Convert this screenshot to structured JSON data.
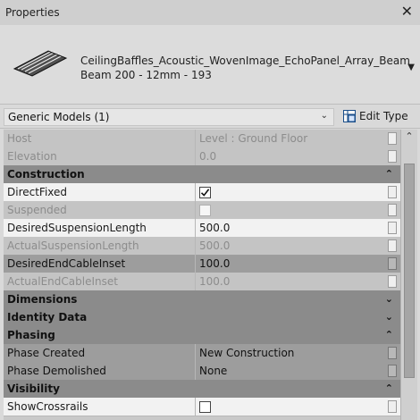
{
  "window": {
    "title": "Properties",
    "close_icon": "close-icon"
  },
  "type_header": {
    "name_line1": "CeilingBaffles_Acoustic_WovenImage_EchoPanel_Array_Beam",
    "name_line2": "Beam 200 - 12mm - 193"
  },
  "selector": {
    "label": "Generic Models (1)",
    "edit_type_label": "Edit Type"
  },
  "rows": [
    {
      "kind": "property",
      "state": "disabled",
      "name": "Host",
      "value": "Level : Ground Floor",
      "value_type": "text"
    },
    {
      "kind": "property",
      "state": "disabled",
      "name": "Elevation",
      "value": "0.0",
      "value_type": "text"
    },
    {
      "kind": "category",
      "name": "Construction",
      "expanded": true
    },
    {
      "kind": "property",
      "state": "normal",
      "name": "DirectFixed",
      "value": "",
      "value_type": "checkbox",
      "checked": true
    },
    {
      "kind": "property",
      "state": "disabled",
      "name": "Suspended",
      "value": "",
      "value_type": "checkbox",
      "checked": false
    },
    {
      "kind": "property",
      "state": "normal",
      "name": "DesiredSuspensionLength",
      "value": "500.0",
      "value_type": "text"
    },
    {
      "kind": "property",
      "state": "disabled",
      "name": "ActualSuspensionLength",
      "value": "500.0",
      "value_type": "text"
    },
    {
      "kind": "property",
      "state": "dark",
      "name": "DesiredEndCableInset",
      "value": "100.0",
      "value_type": "text"
    },
    {
      "kind": "property",
      "state": "disabled",
      "name": "ActualEndCableInset",
      "value": "100.0",
      "value_type": "text"
    },
    {
      "kind": "category",
      "name": "Dimensions",
      "expanded": false
    },
    {
      "kind": "category",
      "name": "Identity Data",
      "expanded": false
    },
    {
      "kind": "category",
      "name": "Phasing",
      "expanded": true
    },
    {
      "kind": "property",
      "state": "dark",
      "name": "Phase Created",
      "value": "New Construction",
      "value_type": "text"
    },
    {
      "kind": "property",
      "state": "dark",
      "name": "Phase Demolished",
      "value": "None",
      "value_type": "text"
    },
    {
      "kind": "category",
      "name": "Visibility",
      "expanded": true
    },
    {
      "kind": "property",
      "state": "normal",
      "name": "ShowCrossrails",
      "value": "",
      "value_type": "checkbox",
      "checked": false
    }
  ],
  "glyphs": {
    "expanded": "⌃",
    "collapsed": "⌄"
  }
}
